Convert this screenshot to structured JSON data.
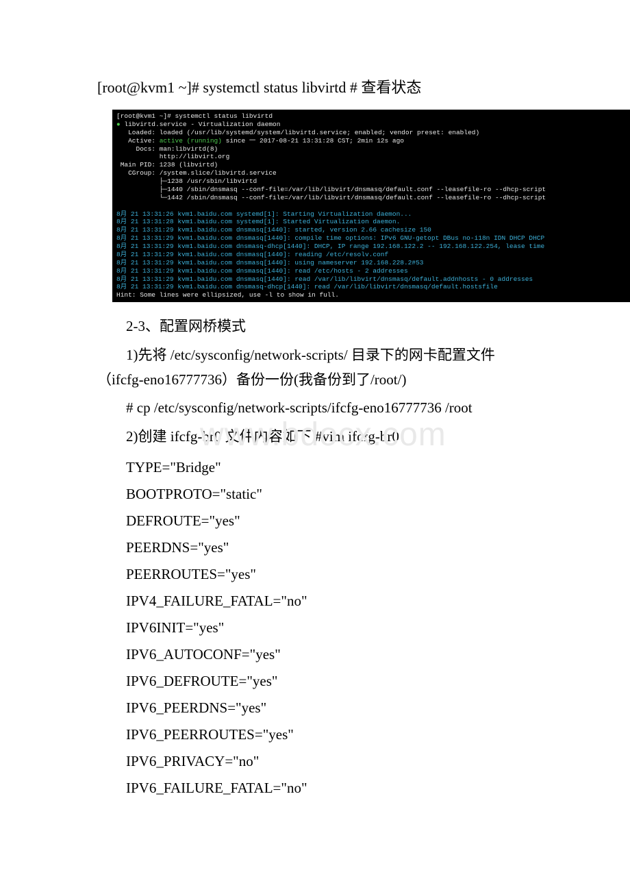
{
  "cmd_header": "[root@kvm1 ~]# systemctl status libvirtd # 查看状态",
  "terminal": {
    "l1a": "[root@kvm1 ~]# systemctl status libvirtd",
    "l2_bullet": "●",
    "l2a": " libvirtd.service - Virtualization daemon",
    "l3": "   Loaded: loaded (/usr/lib/systemd/system/libvirtd.service; enabled; vendor preset: enabled)",
    "l4a": "   Active: ",
    "l4b": "active (running)",
    "l4c": " since 一 2017-08-21 13:31:28 CST; 2min 12s ago",
    "l5": "     Docs: man:libvirtd(8)",
    "l6": "           http://libvirt.org",
    "l7": " Main PID: 1238 (libvirtd)",
    "l8": "   CGroup: /system.slice/libvirtd.service",
    "l9": "           ├─1238 /usr/sbin/libvirtd",
    "l10": "           ├─1440 /sbin/dnsmasq --conf-file=/var/lib/libvirt/dnsmasq/default.conf --leasefile-ro --dhcp-script",
    "l11": "           └─1442 /sbin/dnsmasq --conf-file=/var/lib/libvirt/dnsmasq/default.conf --leasefile-ro --dhcp-script",
    "l12": "",
    "l13": "8月 21 13:31:26 kvm1.baidu.com systemd[1]: Starting Virtualization daemon...",
    "l14": "8月 21 13:31:28 kvm1.baidu.com systemd[1]: Started Virtualization daemon.",
    "l15": "8月 21 13:31:29 kvm1.baidu.com dnsmasq[1440]: started, version 2.66 cachesize 150",
    "l16": "8月 21 13:31:29 kvm1.baidu.com dnsmasq[1440]: compile time options: IPv6 GNU-getopt DBus no-i18n IDN DHCP DHCP",
    "l17": "8月 21 13:31:29 kvm1.baidu.com dnsmasq-dhcp[1440]: DHCP, IP range 192.168.122.2 -- 192.168.122.254, lease time",
    "l18": "8月 21 13:31:29 kvm1.baidu.com dnsmasq[1440]: reading /etc/resolv.conf",
    "l19": "8月 21 13:31:29 kvm1.baidu.com dnsmasq[1440]: using nameserver 192.168.228.2#53",
    "l20": "8月 21 13:31:29 kvm1.baidu.com dnsmasq[1440]: read /etc/hosts - 2 addresses",
    "l21": "8月 21 13:31:29 kvm1.baidu.com dnsmasq[1440]: read /var/lib/libvirt/dnsmasq/default.addnhosts - 0 addresses",
    "l22": "8月 21 13:31:29 kvm1.baidu.com dnsmasq-dhcp[1440]: read /var/lib/libvirt/dnsmasq/default.hostsfile",
    "l23": "Hint: Some lines were ellipsized, use -l to show in full."
  },
  "body": {
    "p1": "2-3、配置网桥模式",
    "p2": "1)先将 /etc/sysconfig/network-scripts/ 目录下的网卡配置文件（ifcfg-eno16777736）备份一份(我备份到了/root/)",
    "p3": "# cp /etc/sysconfig/network-scripts/ifcfg-eno16777736 /root",
    "p4": "2)创建 ifcfg-br0 文件内容如下 #vim ifcfg-br0"
  },
  "cfg": {
    "c1": "TYPE=\"Bridge\"",
    "c2": "BOOTPROTO=\"static\"",
    "c3": "DEFROUTE=\"yes\"",
    "c4": "PEERDNS=\"yes\"",
    "c5": "PEERROUTES=\"yes\"",
    "c6": "IPV4_FAILURE_FATAL=\"no\"",
    "c7": "IPV6INIT=\"yes\"",
    "c8": "IPV6_AUTOCONF=\"yes\"",
    "c9": "IPV6_DEFROUTE=\"yes\"",
    "c10": "IPV6_PEERDNS=\"yes\"",
    "c11": "IPV6_PEERROUTES=\"yes\"",
    "c12": "IPV6_PRIVACY=\"no\"",
    "c13": "IPV6_FAILURE_FATAL=\"no\""
  },
  "watermark": "www.bdocx.com"
}
